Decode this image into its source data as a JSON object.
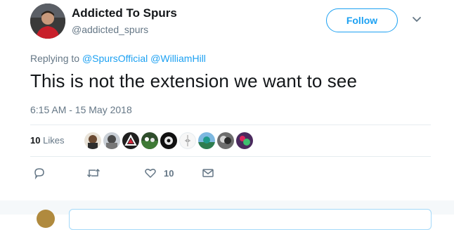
{
  "user": {
    "name": "Addicted To Spurs",
    "handle": "@addicted_spurs",
    "avatar_icon": "profile-avatar"
  },
  "follow_button": {
    "label": "Follow"
  },
  "menu_icon": "chevron-down-icon",
  "reply": {
    "prefix": "Replying to",
    "mentions": [
      "@SpursOfficial",
      "@WilliamHill"
    ]
  },
  "tweet": {
    "text": "This is not the extension we want to see",
    "timestamp": "6:15 AM - 15 May 2018"
  },
  "stats": {
    "likes_count": "10",
    "likes_label": "Likes"
  },
  "likers_count": 9,
  "actions": {
    "reply_icon": "reply-icon",
    "retweet_icon": "retweet-icon",
    "like_icon": "heart-icon",
    "like_count": "10",
    "dm_icon": "envelope-icon"
  },
  "colors": {
    "accent": "#1da1f2",
    "secondary_text": "#657786",
    "primary_text": "#14171a",
    "divider": "#e6ecf0"
  }
}
